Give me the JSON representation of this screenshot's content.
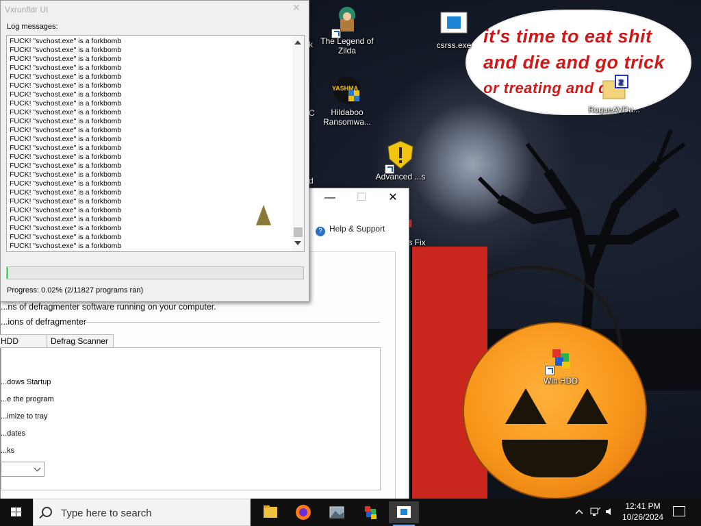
{
  "desktop": {
    "icons": [
      {
        "label": "The Legend of Zilda",
        "shortcut": true
      },
      {
        "label": "csrss.exe",
        "shortcut": false
      },
      {
        "label": "Hildaboo Ransomwa...",
        "badge": "YASHMA",
        "shortcut": false
      },
      {
        "label": "RogueAVDa...",
        "shortcut": false
      },
      {
        "label": "Advanced ...s",
        "shortcut": true
      },
      {
        "label": "...s Fix",
        "shortcut": false
      },
      {
        "label": "Win HDD",
        "shortcut": true
      },
      {
        "label": "k",
        "shortcut": false
      },
      {
        "label": "C",
        "shortcut": false
      },
      {
        "label": "d",
        "shortcut": false
      }
    ],
    "speech_bubble": {
      "line1": "it's time to eat shit",
      "line2": "and die and go trick",
      "line3": "or treating and die!"
    }
  },
  "defrag_window": {
    "help_link": "Help & Support",
    "description": "...ns of defragmenter software running on your computer.",
    "section": "...ions of defragmenter",
    "tabs": [
      "HDD Repair",
      "Defrag Scanner"
    ],
    "options": [
      "...dows Startup",
      "...e the program",
      "...imize to tray",
      "...dates",
      "...ks"
    ],
    "controls": {
      "minimize": "—",
      "maximize": "☐",
      "close": "✕"
    }
  },
  "vx_window": {
    "title": "Vxrunfldr UI",
    "close": "✕",
    "log_label": "Log messages:",
    "log_line": "FUCK! \"svchost.exe\" is a forkbomb",
    "log_count": 24,
    "progress_fraction": 0.0002,
    "progress_text": "Progress: 0.02% (2/11827 programs ran)"
  },
  "taskbar": {
    "search_placeholder": "Type here to search",
    "pinned": [
      "file-explorer-icon",
      "firefox-icon",
      "photos-icon",
      "winhdd-icon",
      "app-window-icon"
    ],
    "time": "12:41 PM",
    "date": "10/26/2024",
    "colors": {
      "accent": "#7aa7e0",
      "progress": "#06b025"
    }
  }
}
